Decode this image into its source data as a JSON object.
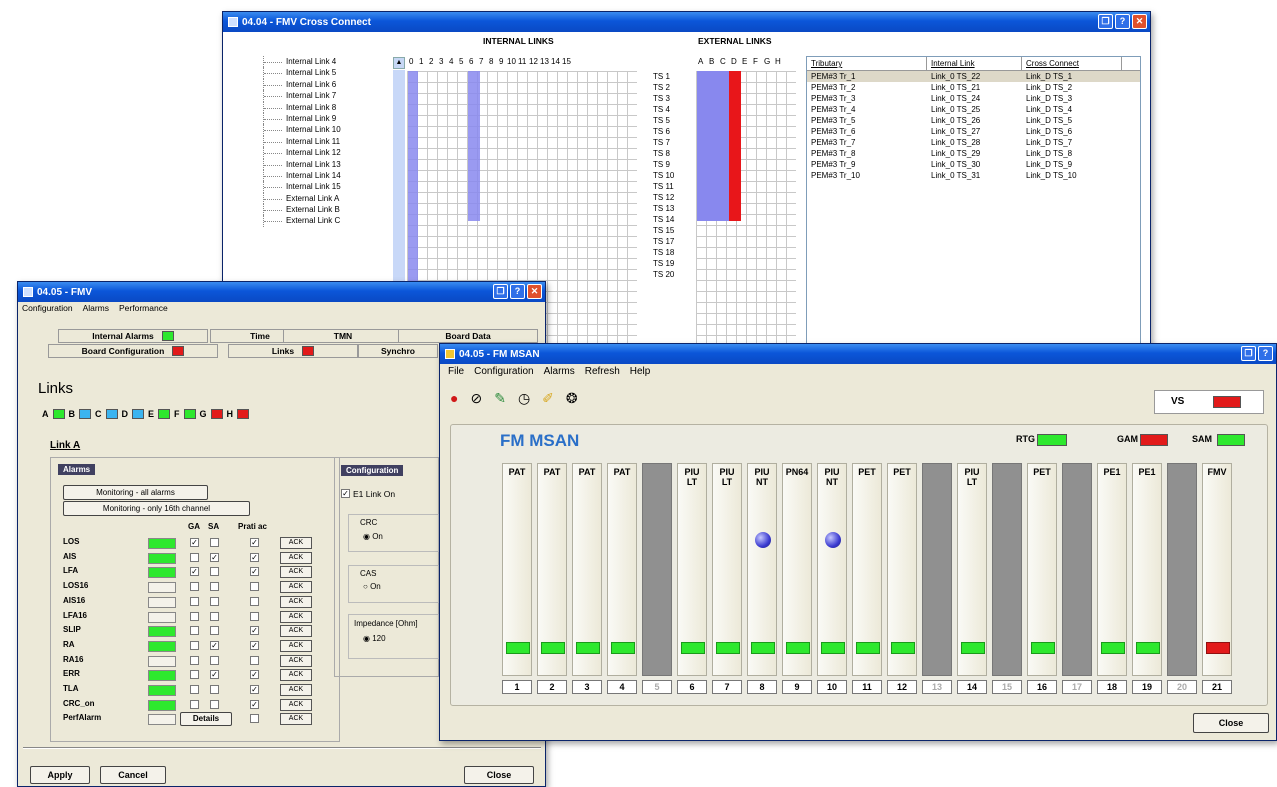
{
  "cross": {
    "title": "04.04 - FMV Cross Connect",
    "internal_links_title": "INTERNAL LINKS",
    "external_links_title": "EXTERNAL LINKS",
    "internal_cols": [
      "0",
      "1",
      "2",
      "3",
      "4",
      "5",
      "6",
      "7",
      "8",
      "9",
      "10",
      "11",
      "12",
      "13",
      "14",
      "15"
    ],
    "external_cols": [
      "A",
      "B",
      "C",
      "D",
      "E",
      "F",
      "G",
      "H"
    ],
    "tree": [
      "Internal Link 4",
      "Internal Link 5",
      "Internal Link 6",
      "Internal Link 7",
      "Internal Link 8",
      "Internal Link 9",
      "Internal Link 10",
      "Internal Link 11",
      "Internal Link 12",
      "Internal Link 13",
      "Internal Link 14",
      "Internal Link 15",
      "External Link A",
      "External Link B",
      "External Link C"
    ],
    "ts": [
      "TS 1",
      "TS 2",
      "TS 3",
      "TS 4",
      "TS 5",
      "TS 6",
      "TS 7",
      "TS 8",
      "TS 9",
      "TS 10",
      "TS 11",
      "TS 12",
      "TS 13",
      "TS 14",
      "TS 15",
      "TS 17",
      "TS 18",
      "TS 19",
      "TS 20"
    ],
    "table_headers": [
      "Tributary",
      "Internal Link",
      "Cross Connect"
    ],
    "table_rows": [
      [
        "PEM#3 Tr_1",
        "Link_0 TS_22",
        "Link_D TS_1"
      ],
      [
        "PEM#3 Tr_2",
        "Link_0 TS_21",
        "Link_D TS_2"
      ],
      [
        "PEM#3 Tr_3",
        "Link_0 TS_24",
        "Link_D TS_3"
      ],
      [
        "PEM#3 Tr_4",
        "Link_0 TS_25",
        "Link_D TS_4"
      ],
      [
        "PEM#3 Tr_5",
        "Link_0 TS_26",
        "Link_D TS_5"
      ],
      [
        "PEM#3 Tr_6",
        "Link_0 TS_27",
        "Link_D TS_6"
      ],
      [
        "PEM#3 Tr_7",
        "Link_0 TS_28",
        "Link_D TS_7"
      ],
      [
        "PEM#3 Tr_8",
        "Link_0 TS_29",
        "Link_D TS_8"
      ],
      [
        "PEM#3 Tr_9",
        "Link_0 TS_30",
        "Link_D TS_9"
      ],
      [
        "PEM#3 Tr_10",
        "Link_0 TS_31",
        "Link_D TS_10"
      ]
    ]
  },
  "fmv": {
    "title": "04.05 - FMV",
    "menu": [
      "Configuration",
      "Alarms",
      "Performance"
    ],
    "tabs_row1": [
      "Internal Alarms",
      "Time",
      "TMN",
      "Board Data"
    ],
    "tabs_row2": [
      "Board Configuration",
      "Links",
      "Synchro"
    ],
    "section_title": "Links",
    "link_letters": [
      "A",
      "B",
      "C",
      "D",
      "E",
      "F",
      "G",
      "H"
    ],
    "link_sub": "Link A",
    "alarms_title": "Alarms",
    "monitor_all": "Monitoring - all alarms",
    "monitor_16": "Monitoring - only 16th channel",
    "col_headers": [
      "GA",
      "SA",
      "Prati ac"
    ],
    "alarm_rows": [
      "LOS",
      "AIS",
      "LFA",
      "LOS16",
      "AIS16",
      "LFA16",
      "SLIP",
      "RA",
      "RA16",
      "ERR",
      "TLA",
      "CRC_on",
      "PerfAlarm"
    ],
    "ack": "ACK",
    "details": "Details",
    "config_title": "Configuration",
    "e1_link": "E1 Link On",
    "crc": "CRC",
    "crc_on": "On",
    "cas": "CAS",
    "cas_on": "On",
    "impedance": "Impedance [Ohm]",
    "imp_val": "120",
    "apply": "Apply",
    "cancel": "Cancel",
    "close": "Close"
  },
  "msan": {
    "title": "04.05 - FM MSAN",
    "menu": [
      "File",
      "Configuration",
      "Alarms",
      "Refresh",
      "Help"
    ],
    "vs": "VS",
    "heading": "FM MSAN",
    "rtg": "RTG",
    "gam": "GAM",
    "sam": "SAM",
    "slots": [
      {
        "n": "1",
        "l1": "PAT",
        "l2": "",
        "e": false,
        "led": "g"
      },
      {
        "n": "2",
        "l1": "PAT",
        "l2": "",
        "e": false,
        "led": "g"
      },
      {
        "n": "3",
        "l1": "PAT",
        "l2": "",
        "e": false,
        "led": "g"
      },
      {
        "n": "4",
        "l1": "PAT",
        "l2": "",
        "e": false,
        "led": "g"
      },
      {
        "n": "5",
        "l1": "",
        "l2": "",
        "e": true,
        "led": ""
      },
      {
        "n": "6",
        "l1": "PIU",
        "l2": "LT",
        "e": false,
        "led": "g"
      },
      {
        "n": "7",
        "l1": "PIU",
        "l2": "LT",
        "e": false,
        "led": "g"
      },
      {
        "n": "8",
        "l1": "PIU",
        "l2": "NT",
        "e": false,
        "led": "g",
        "knob": true
      },
      {
        "n": "9",
        "l1": "PN64",
        "l2": "",
        "e": false,
        "led": "g"
      },
      {
        "n": "10",
        "l1": "PIU",
        "l2": "NT",
        "e": false,
        "led": "g",
        "knob": true
      },
      {
        "n": "11",
        "l1": "PET",
        "l2": "",
        "e": false,
        "led": "g"
      },
      {
        "n": "12",
        "l1": "PET",
        "l2": "",
        "e": false,
        "led": "g"
      },
      {
        "n": "13",
        "l1": "",
        "l2": "",
        "e": true,
        "led": ""
      },
      {
        "n": "14",
        "l1": "PIU",
        "l2": "LT",
        "e": false,
        "led": "g"
      },
      {
        "n": "15",
        "l1": "",
        "l2": "",
        "e": true,
        "led": ""
      },
      {
        "n": "16",
        "l1": "PET",
        "l2": "",
        "e": false,
        "led": "g"
      },
      {
        "n": "17",
        "l1": "",
        "l2": "",
        "e": true,
        "led": ""
      },
      {
        "n": "18",
        "l1": "PE1",
        "l2": "",
        "e": false,
        "led": "g"
      },
      {
        "n": "19",
        "l1": "PE1",
        "l2": "",
        "e": false,
        "led": "g"
      },
      {
        "n": "20",
        "l1": "",
        "l2": "",
        "e": true,
        "led": ""
      },
      {
        "n": "21",
        "l1": "FMV",
        "l2": "",
        "e": false,
        "led": "r"
      }
    ],
    "close": "Close"
  }
}
